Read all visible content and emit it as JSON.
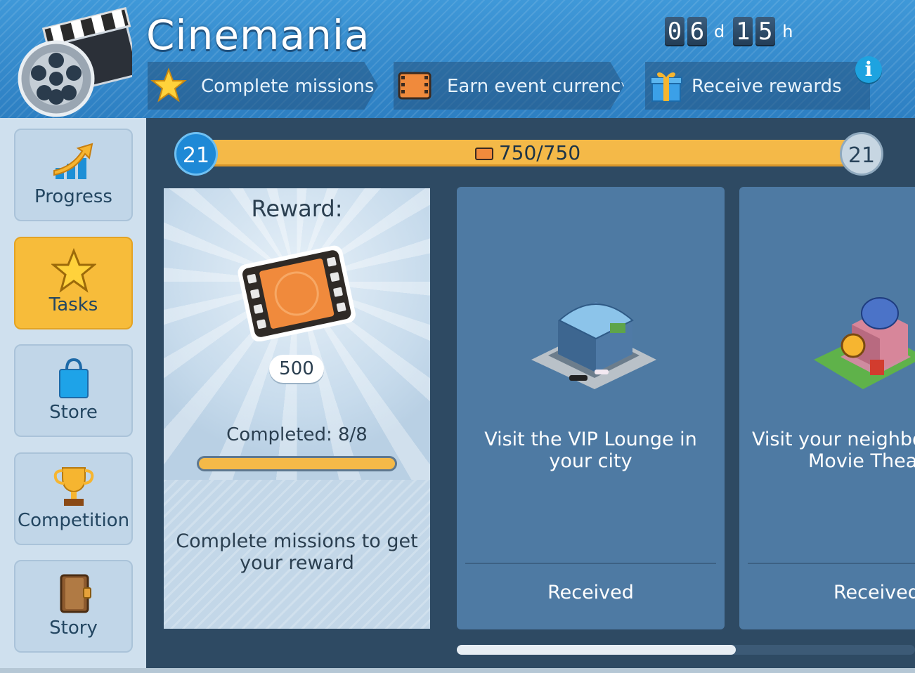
{
  "header": {
    "title": "Cinemania",
    "timer": {
      "days_digits": [
        "0",
        "6"
      ],
      "days_unit": "d",
      "hours_digits": [
        "1",
        "5"
      ],
      "hours_unit": "h"
    },
    "steps": [
      {
        "label": "Complete missions",
        "icon": "star-icon"
      },
      {
        "label": "Earn event currency",
        "icon": "film-ticket-icon"
      },
      {
        "label": "Receive rewards",
        "icon": "gift-icon"
      }
    ],
    "info_label": "i"
  },
  "sidebar": {
    "items": [
      {
        "label": "Progress",
        "icon": "progress-arrow-icon",
        "active": false
      },
      {
        "label": "Tasks",
        "icon": "star-icon",
        "active": true
      },
      {
        "label": "Store",
        "icon": "shopping-bag-icon",
        "active": false
      },
      {
        "label": "Competition",
        "icon": "trophy-icon",
        "active": false
      },
      {
        "label": "Story",
        "icon": "book-icon",
        "active": false
      }
    ]
  },
  "progress": {
    "current_level": "21",
    "next_level": "21",
    "value_text": "750/750",
    "fraction": 1.0
  },
  "reward_card": {
    "title": "Reward:",
    "amount": "500",
    "completed_text": "Completed: 8/8",
    "completed_fraction": 1.0,
    "hint": "Complete missions to get your reward"
  },
  "missions": [
    {
      "text": "Visit the VIP Lounge in your city",
      "status": "Received",
      "icon": "vip-lounge-building-icon"
    },
    {
      "text": "Visit your neighbo Movie Theat",
      "status": "Received",
      "icon": "movie-theater-building-icon"
    }
  ],
  "colors": {
    "accent": "#f7bc3a",
    "header_blue": "#3f98d8",
    "card_blue": "#4e7aa3",
    "bg_dark": "#2e4a63"
  }
}
